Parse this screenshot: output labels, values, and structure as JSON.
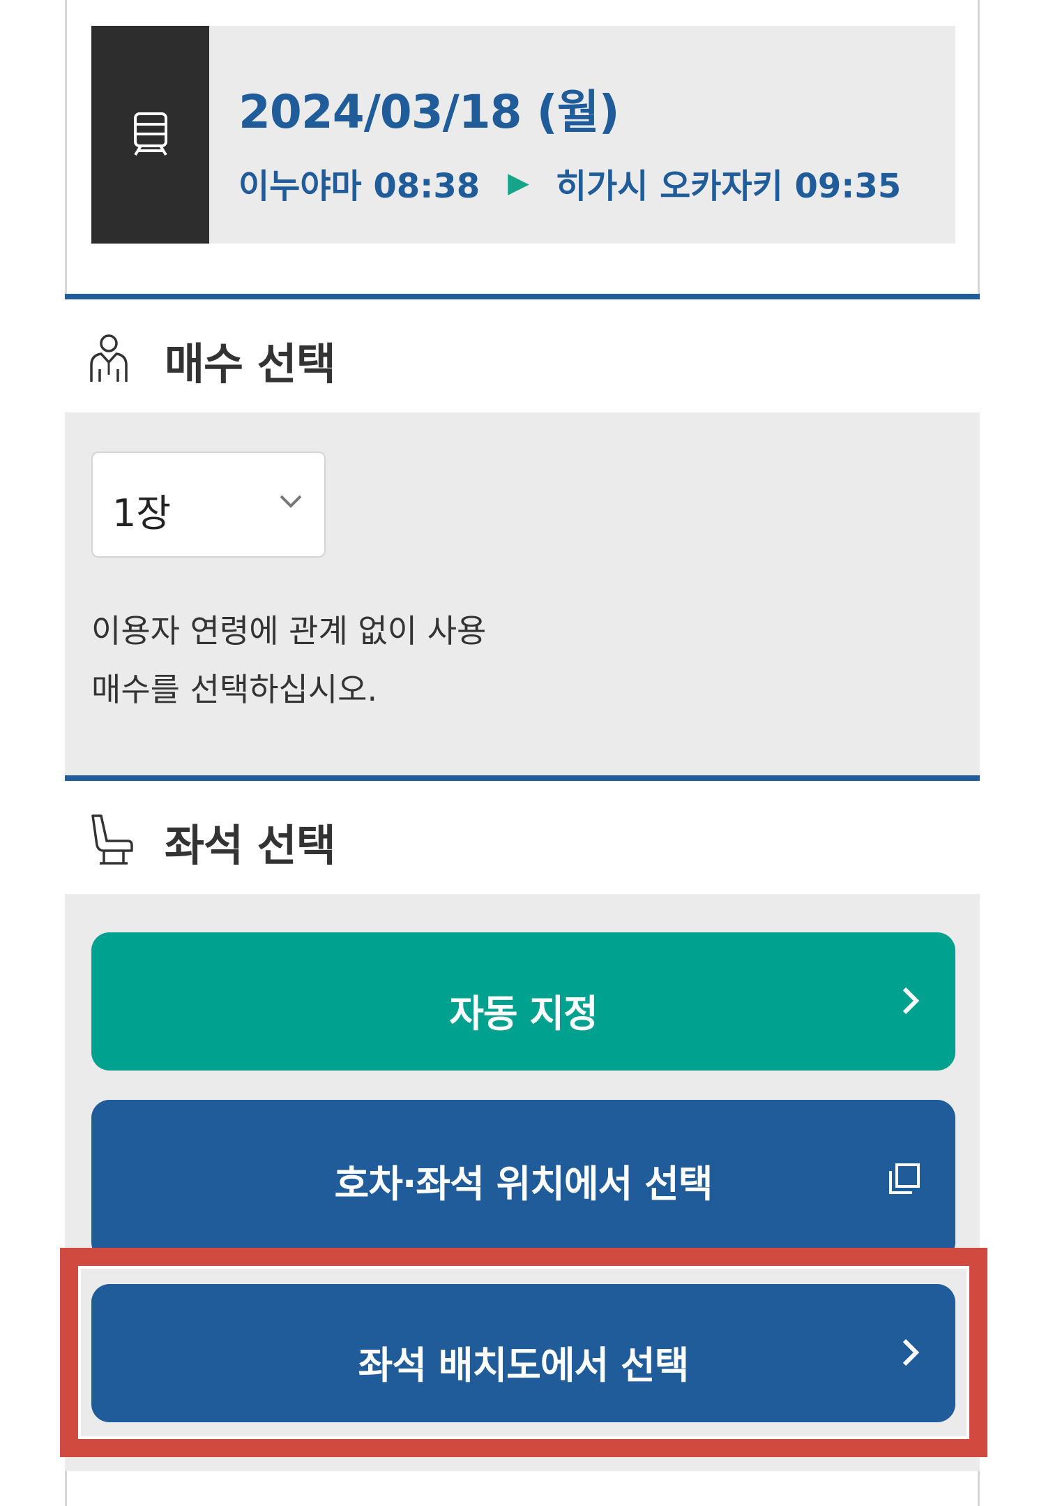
{
  "trip": {
    "icon": "train-icon",
    "date": "2024/03/18 (월)",
    "departure": "이누야마 08:38",
    "arrow": "▶",
    "arrival": "히가시 오카자키 09:35"
  },
  "ticket_section": {
    "icon": "person-icon",
    "title": "매수 선택",
    "quantity_value": "1장",
    "note_line1": "이용자 연령에 관계 없이 사용",
    "note_line2": "매수를 선택하십시오."
  },
  "seat_section": {
    "icon": "seat-icon",
    "title": "좌석 선택",
    "auto_label": "자동 지정",
    "car_position_label": "호차·좌석 위치에서 선택",
    "seat_map_label": "좌석 배치도에서 선택"
  },
  "colors": {
    "brand_blue": "#1f5c99",
    "auto_green": "#00a28f",
    "highlight_red": "#d04a40",
    "panel_gray": "#ebebeb"
  }
}
